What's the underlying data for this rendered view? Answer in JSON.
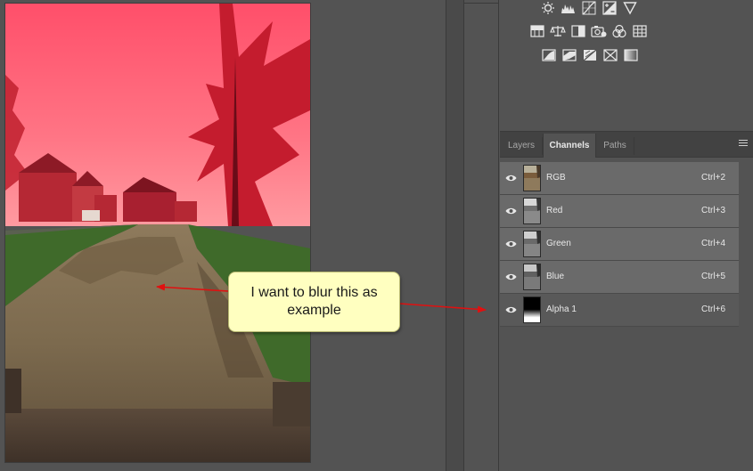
{
  "annotation": {
    "text": "I want to blur this as example"
  },
  "adjustments": {
    "rows": [
      [
        "brightness-contrast-icon",
        "levels-icon",
        "curves-icon",
        "exposure-icon",
        "vibrance-icon"
      ],
      [
        "hue-saturation-icon",
        "color-balance-icon",
        "black-white-icon",
        "photo-filter-icon",
        "channel-mixer-icon",
        "color-lookup-icon"
      ],
      [
        "invert-icon",
        "posterize-icon",
        "threshold-icon",
        "selective-color-icon",
        "gradient-map-icon"
      ]
    ]
  },
  "tabs": [
    {
      "label": "Layers",
      "active": false
    },
    {
      "label": "Channels",
      "active": true
    },
    {
      "label": "Paths",
      "active": false
    }
  ],
  "channels": [
    {
      "name": "RGB",
      "shortcut": "Ctrl+2",
      "thumb": "color",
      "selected": true
    },
    {
      "name": "Red",
      "shortcut": "Ctrl+3",
      "thumb": "gray",
      "selected": true
    },
    {
      "name": "Green",
      "shortcut": "Ctrl+4",
      "thumb": "gray",
      "selected": true
    },
    {
      "name": "Blue",
      "shortcut": "Ctrl+5",
      "thumb": "gray",
      "selected": true
    },
    {
      "name": "Alpha 1",
      "shortcut": "Ctrl+6",
      "thumb": "alpha",
      "selected": false
    }
  ],
  "colors": {
    "overlay": "#ff3a55",
    "arrow": "#e01010",
    "callout_bg": "#ffffc0"
  }
}
